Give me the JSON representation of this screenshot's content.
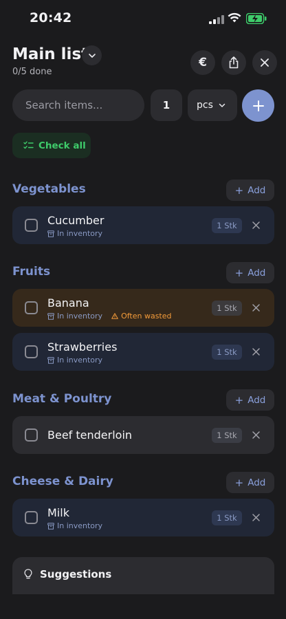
{
  "status": {
    "time": "20:42"
  },
  "header": {
    "title": "Main list",
    "progress": "0/5 done"
  },
  "toolbar": {
    "search_placeholder": "Search items...",
    "quantity": "1",
    "unit": "pcs",
    "check_all": "Check all"
  },
  "sections": [
    {
      "title": "Vegetables",
      "add_label": "Add",
      "items": [
        {
          "name": "Cucumber",
          "qty": "1 Stk",
          "inventory": "In inventory"
        }
      ]
    },
    {
      "title": "Fruits",
      "add_label": "Add",
      "items": [
        {
          "name": "Banana",
          "qty": "1 Stk",
          "inventory": "In inventory",
          "warning": "Often wasted"
        },
        {
          "name": "Strawberries",
          "qty": "1 Stk",
          "inventory": "In inventory"
        }
      ]
    },
    {
      "title": "Meat & Poultry",
      "add_label": "Add",
      "items": [
        {
          "name": "Beef tenderloin",
          "qty": "1 Stk"
        }
      ]
    },
    {
      "title": "Cheese & Dairy",
      "add_label": "Add",
      "items": [
        {
          "name": "Milk",
          "qty": "1 Stk",
          "inventory": "In inventory"
        }
      ]
    }
  ],
  "suggestions": {
    "title": "Suggestions"
  },
  "colors": {
    "accent": "#7d93cf",
    "success": "#3ecb6a",
    "warning": "#f39b3a",
    "background": "#1b1b1d"
  }
}
